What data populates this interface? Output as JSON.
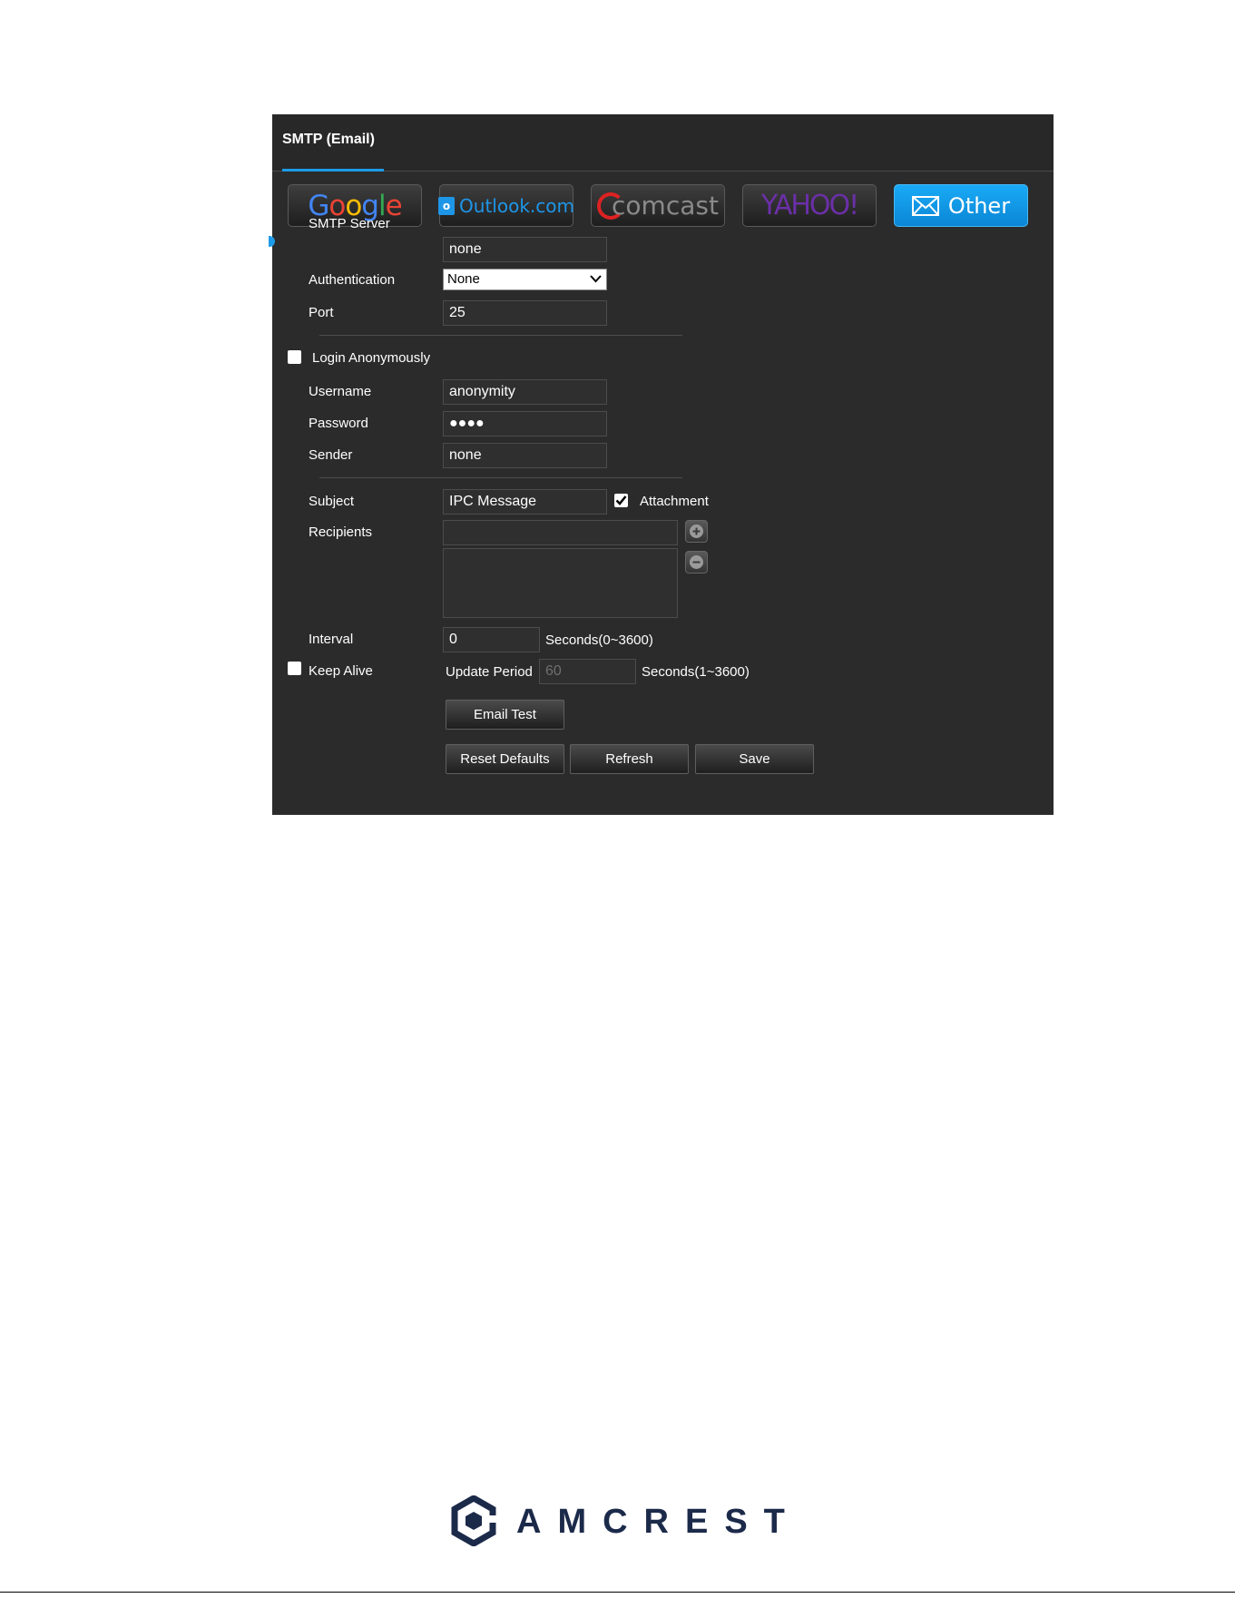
{
  "tab": {
    "label": "SMTP (Email)"
  },
  "providers": {
    "google": "Google",
    "outlook": "Outlook.com",
    "comcast": "comcast",
    "yahoo": "YAHOO!",
    "other": "Other"
  },
  "form": {
    "smtp_server_label": "SMTP Server",
    "smtp_server_value": "none",
    "authentication_label": "Authentication",
    "authentication_value": "None",
    "port_label": "Port",
    "port_value": "25",
    "login_anonymously_label": "Login Anonymously",
    "login_anonymously_checked": false,
    "username_label": "Username",
    "username_value": "anonymity",
    "password_label": "Password",
    "password_value": "●●●●",
    "sender_label": "Sender",
    "sender_value": "none",
    "subject_label": "Subject",
    "subject_value": "IPC Message",
    "attachment_label": "Attachment",
    "attachment_checked": true,
    "recipients_label": "Recipients",
    "recipients_value": "",
    "interval_label": "Interval",
    "interval_value": "0",
    "interval_unit": "Seconds(0~3600)",
    "keep_alive_label": "Keep Alive",
    "keep_alive_checked": false,
    "update_period_label": "Update Period",
    "update_period_value": "60",
    "update_period_unit": "Seconds(1~3600)"
  },
  "buttons": {
    "email_test": "Email Test",
    "reset_defaults": "Reset Defaults",
    "refresh": "Refresh",
    "save": "Save"
  },
  "brand": {
    "name": "AMCREST"
  },
  "colors": {
    "accent": "#1e9be8",
    "panel": "#2b2b2b"
  }
}
